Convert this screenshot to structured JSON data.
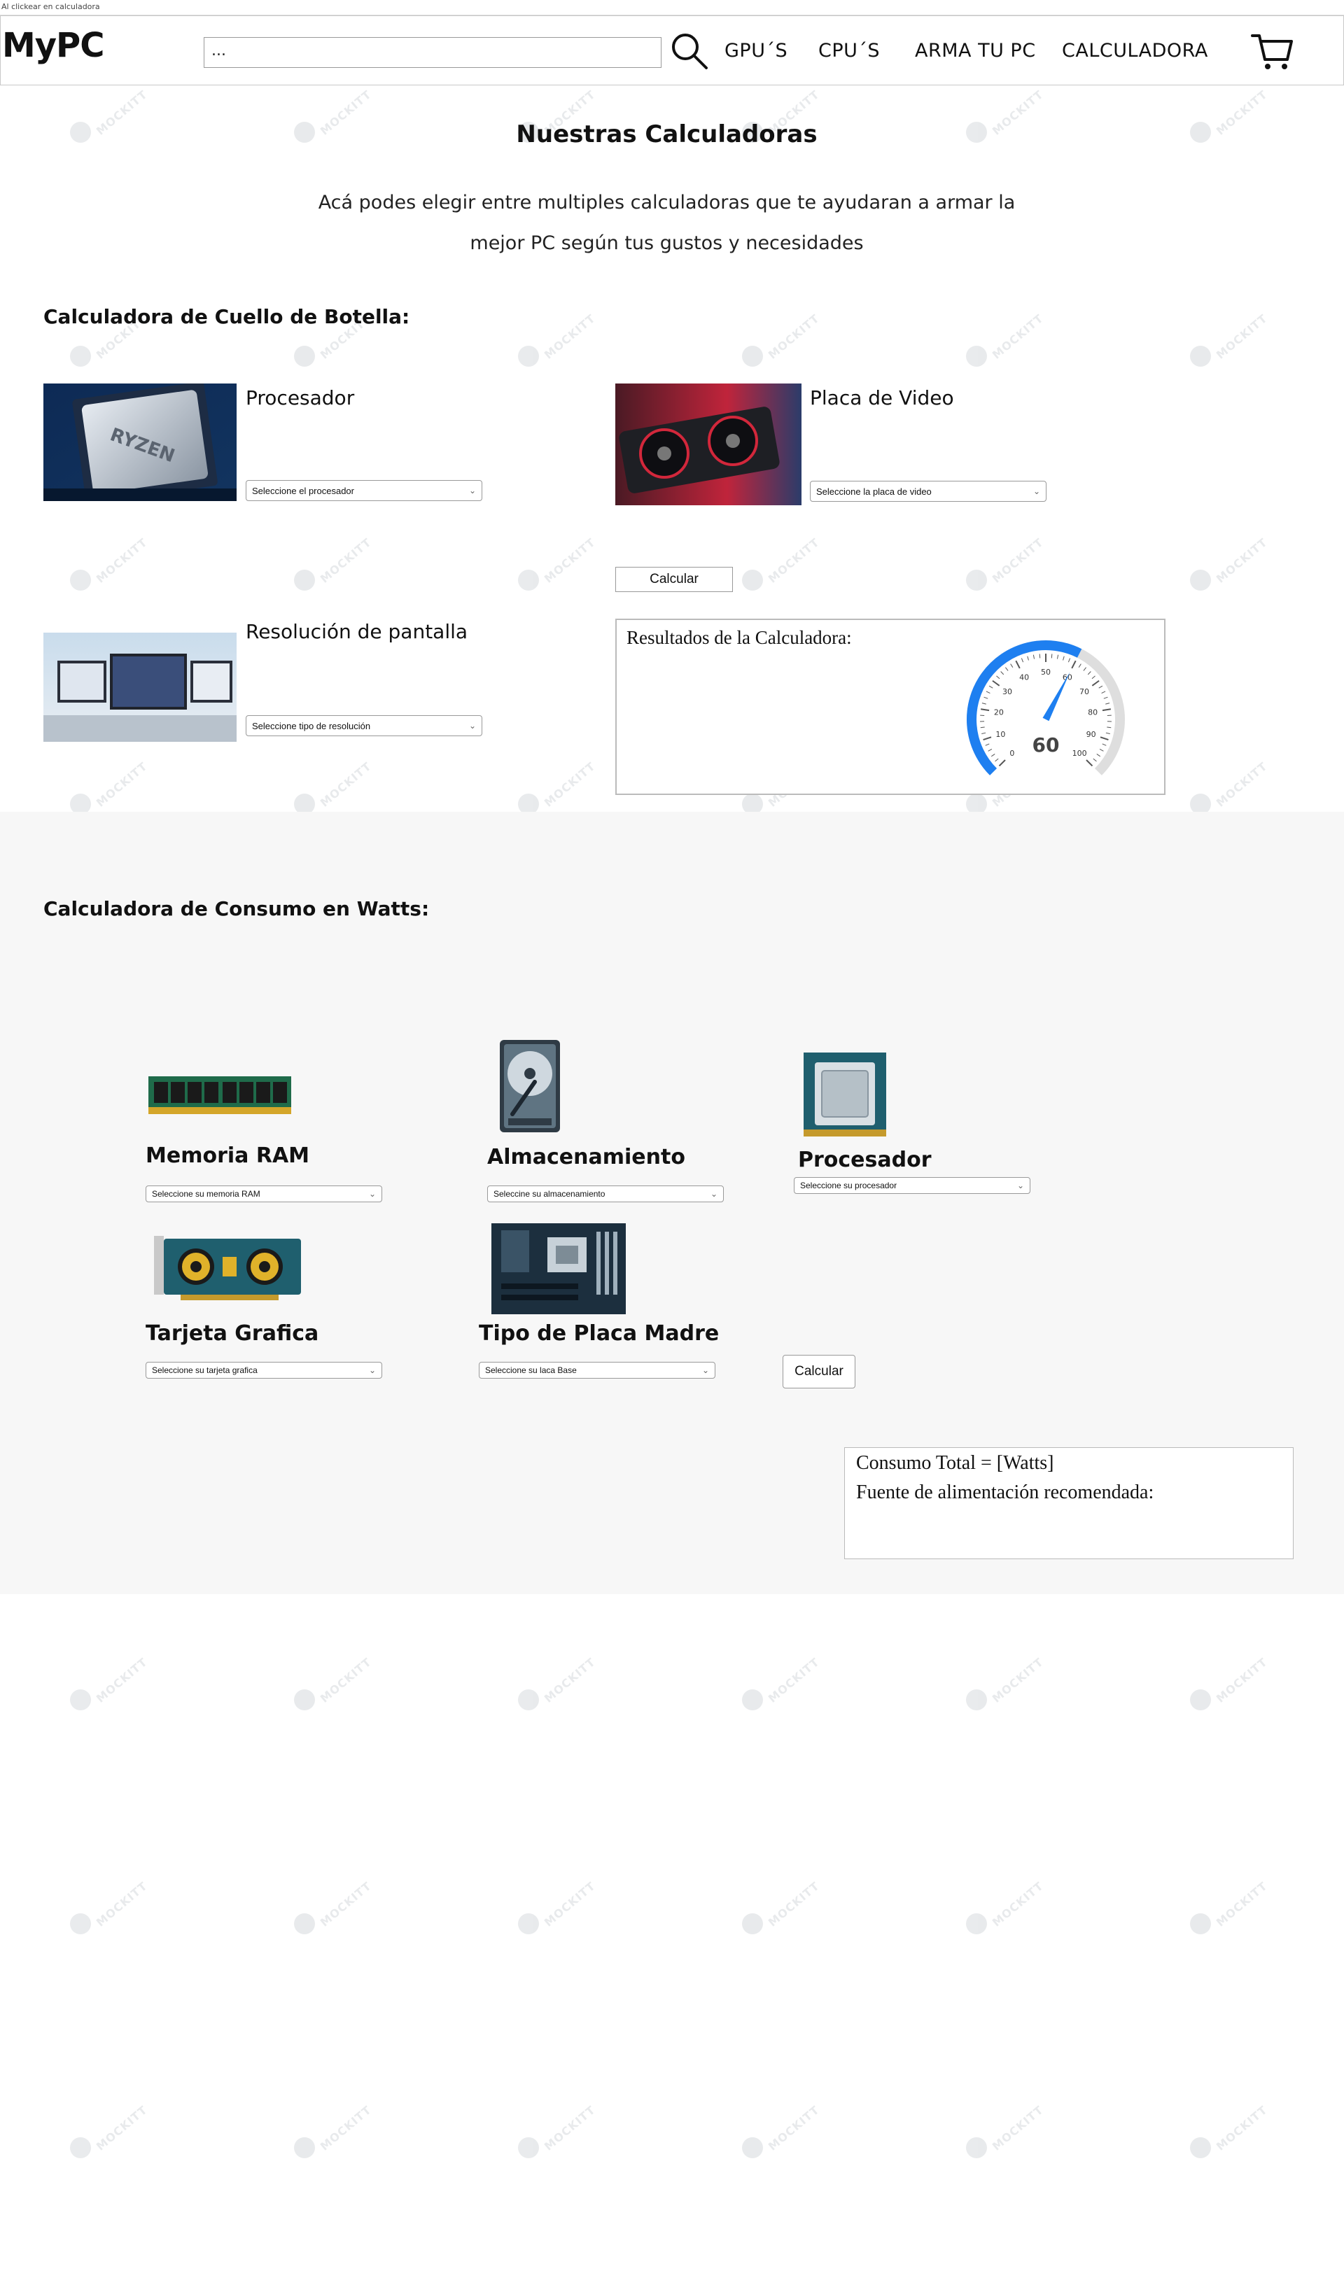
{
  "top_note": "Al clickear en calculadora",
  "header": {
    "logo": "MyPC",
    "search_value": "...",
    "nav": [
      "GPU´S",
      "CPU´S",
      "ARMA TU PC",
      "CALCULADORA"
    ]
  },
  "main": {
    "title": "Nuestras Calculadoras",
    "intro_line1": "Acá podes elegir entre multiples calculadoras que te ayudaran a armar la",
    "intro_line2": "mejor PC según tus gustos y necesidades"
  },
  "bottleneck": {
    "title": "Calculadora de Cuello de Botella:",
    "processor_label": "Procesador",
    "processor_select": "Seleccione el procesador",
    "gpu_label": "Placa de Video",
    "gpu_select": "Seleccione la placa de video",
    "resolution_label": "Resolución de pantalla",
    "resolution_select": "Seleccione tipo de resolución",
    "calc_button": "Calcular",
    "results_title": "Resultados de la Calculadora:",
    "gauge": {
      "value": 60,
      "min": 0,
      "max": 100,
      "ticks": [
        "0",
        "10",
        "20",
        "30",
        "40",
        "50",
        "60",
        "70",
        "80",
        "90",
        "100"
      ],
      "accent": "#1e7ff0"
    }
  },
  "watts": {
    "title": "Calculadora de Consumo en Watts:",
    "ram_label": "Memoria RAM",
    "ram_select": "Seleccione su memoria RAM",
    "storage_label": "Almacenamiento",
    "storage_select": "Seleccine su almacenamiento",
    "cpu_label": "Procesador",
    "cpu_select": "Seleccione su procesador",
    "gpu_label": "Tarjeta Grafica",
    "gpu_select": "Seleccione su tarjeta grafica",
    "mobo_label": "Tipo de Placa Madre",
    "mobo_select": "Seleccione su laca Base",
    "calc_button": "Calcular",
    "total_line": "Consumo Total =  [Watts]",
    "psu_line": "Fuente de alimentación recomendada:"
  },
  "watermark": "MOCKITT"
}
